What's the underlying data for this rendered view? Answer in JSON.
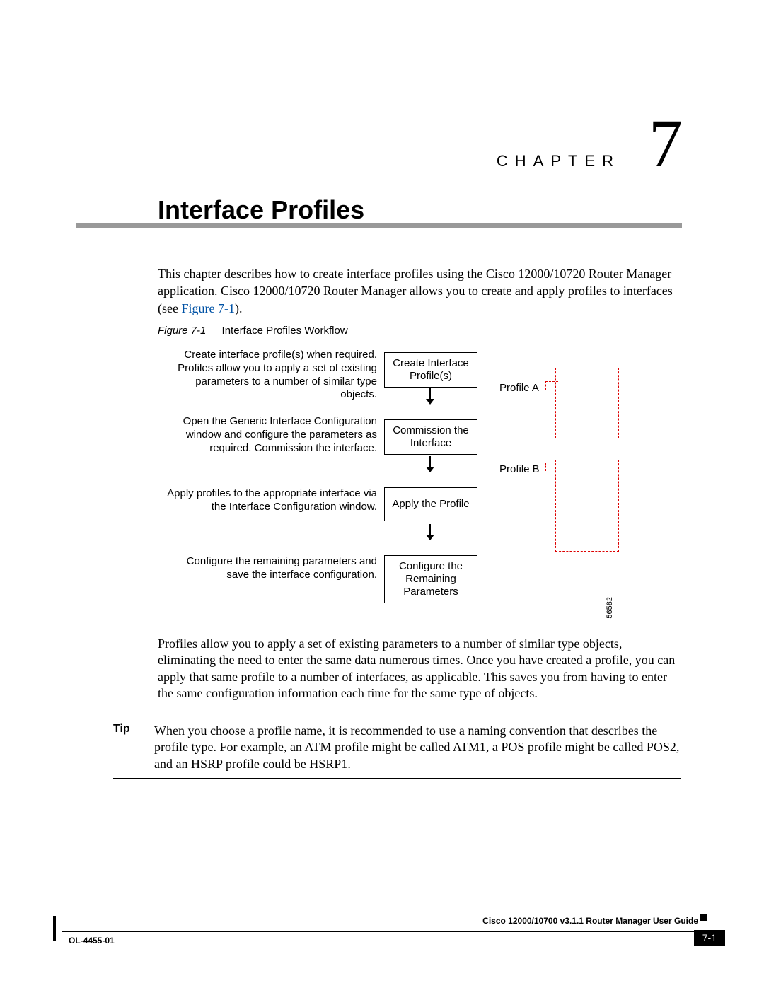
{
  "chapter": {
    "label": "CHAPTER",
    "number": "7"
  },
  "title": "Interface Profiles",
  "intro": {
    "text_before": "This chapter describes how to create interface profiles using the Cisco 12000/10720 Router Manager application. Cisco 12000/10720 Router Manager allows you to create and apply profiles to interfaces (see ",
    "figref": "Figure 7-1",
    "text_after": ")."
  },
  "figure": {
    "label": "Figure 7-1",
    "caption": "Interface Profiles Workflow",
    "id": "56582",
    "steps": {
      "s1_text": "Create interface profile(s) when required. Profiles allow you to apply a set of existing parameters to a number of similar type objects.",
      "s1_box": "Create Interface Profile(s)",
      "s2_text": "Open the Generic Interface Configuration window and configure the parameters as required. Commission the interface.",
      "s2_box": "Commission the Interface",
      "s3_text": "Apply profiles to the appropriate interface via the Interface Configuration window.",
      "s3_box": "Apply the Profile",
      "s4_text": "Configure the remaining parameters and save the interface configuration.",
      "s4_box": "Configure the Remaining Parameters"
    },
    "profiles": {
      "a": "Profile A",
      "b": "Profile B"
    }
  },
  "body_para": "Profiles allow you to apply a set of existing parameters to a number of similar type objects, eliminating the need to enter the same data numerous times. Once you have created a profile, you can apply that same profile to a number of interfaces, as applicable. This saves you from having to enter the same configuration information each time for the same type of objects.",
  "tip": {
    "label": "Tip",
    "text": "When you choose a profile name, it is recommended to use a naming convention that describes the profile type. For example, an ATM profile might be called ATM1, a POS profile might be called POS2, and an HSRP profile could be HSRP1."
  },
  "footer": {
    "doc_title": "Cisco 12000/10700 v3.1.1 Router Manager User Guide",
    "ol": "OL-4455-01",
    "page": "7-1"
  }
}
